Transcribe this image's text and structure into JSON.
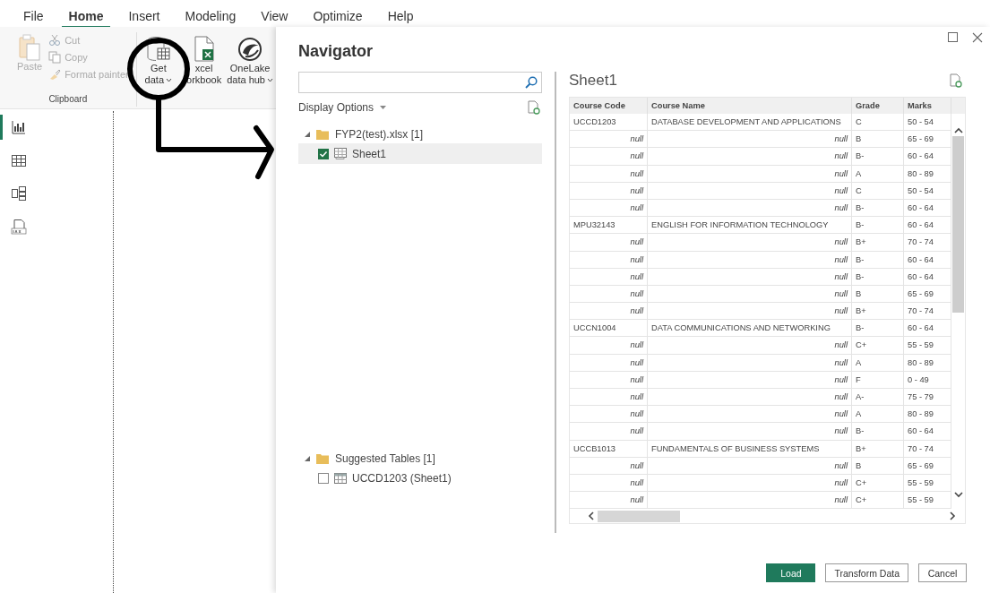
{
  "menu": [
    {
      "label": "File",
      "selected": false
    },
    {
      "label": "Home",
      "selected": true
    },
    {
      "label": "Insert",
      "selected": false
    },
    {
      "label": "Modeling",
      "selected": false
    },
    {
      "label": "View",
      "selected": false
    },
    {
      "label": "Optimize",
      "selected": false
    },
    {
      "label": "Help",
      "selected": false
    }
  ],
  "ribbon": {
    "clipboard": {
      "paste": "Paste",
      "cut": "Cut",
      "copy": "Copy",
      "format_painter": "Format painter",
      "label": "Clipboard",
      "disabled": true
    },
    "get_data": {
      "line1": "Get",
      "line2": "data"
    },
    "excel": {
      "line1": "xcel",
      "line2": "orkbook"
    },
    "onelake": {
      "line1": "OneLake",
      "line2": "data hub"
    }
  },
  "sidebar": [
    {
      "kind": "report",
      "selected": true
    },
    {
      "kind": "table",
      "selected": false
    },
    {
      "kind": "model",
      "selected": false
    },
    {
      "kind": "dax",
      "selected": false
    }
  ],
  "navigator": {
    "title": "Navigator",
    "display_options": "Display Options",
    "tree": [
      {
        "label": "FYP2(test).xlsx [1]",
        "expanded": true,
        "children": [
          {
            "label": "Sheet1",
            "kind": "sheet",
            "checked": true,
            "selected": true
          }
        ]
      },
      {
        "label": "Suggested Tables [1]",
        "expanded": true,
        "children": [
          {
            "label": "UCCD1203 (Sheet1)",
            "kind": "table",
            "checked": false,
            "selected": false
          }
        ]
      }
    ]
  },
  "preview": {
    "title": "Sheet1",
    "columns": [
      "Course Code",
      "Course Name",
      "Grade",
      "Marks"
    ],
    "rows": [
      {
        "kind": "course",
        "cells": [
          "UCCD1203",
          "DATABASE DEVELOPMENT AND APPLICATIONS",
          "C",
          "50 - 54"
        ]
      },
      {
        "kind": "null",
        "cells": [
          "null",
          "null",
          "B",
          "65 - 69"
        ]
      },
      {
        "kind": "null",
        "cells": [
          "null",
          "null",
          "B-",
          "60 - 64"
        ]
      },
      {
        "kind": "null",
        "cells": [
          "null",
          "null",
          "A",
          "80 - 89"
        ]
      },
      {
        "kind": "null",
        "cells": [
          "null",
          "null",
          "C",
          "50 - 54"
        ]
      },
      {
        "kind": "null",
        "cells": [
          "null",
          "null",
          "B-",
          "60 - 64"
        ]
      },
      {
        "kind": "course",
        "cells": [
          "MPU32143",
          "ENGLISH FOR INFORMATION TECHNOLOGY",
          "B-",
          "60 - 64"
        ]
      },
      {
        "kind": "null",
        "cells": [
          "null",
          "null",
          "B+",
          "70 - 74"
        ]
      },
      {
        "kind": "null",
        "cells": [
          "null",
          "null",
          "B-",
          "60 - 64"
        ]
      },
      {
        "kind": "null",
        "cells": [
          "null",
          "null",
          "B-",
          "60 - 64"
        ]
      },
      {
        "kind": "null",
        "cells": [
          "null",
          "null",
          "B",
          "65 - 69"
        ]
      },
      {
        "kind": "null",
        "cells": [
          "null",
          "null",
          "B+",
          "70 - 74"
        ]
      },
      {
        "kind": "course",
        "cells": [
          "UCCN1004",
          "DATA COMMUNICATIONS AND NETWORKING",
          "B-",
          "60 - 64"
        ]
      },
      {
        "kind": "null",
        "cells": [
          "null",
          "null",
          "C+",
          "55 - 59"
        ]
      },
      {
        "kind": "null",
        "cells": [
          "null",
          "null",
          "A",
          "80 - 89"
        ]
      },
      {
        "kind": "null",
        "cells": [
          "null",
          "null",
          "F",
          "0 - 49"
        ]
      },
      {
        "kind": "null",
        "cells": [
          "null",
          "null",
          "A-",
          "75 - 79"
        ]
      },
      {
        "kind": "null",
        "cells": [
          "null",
          "null",
          "A",
          "80 - 89"
        ]
      },
      {
        "kind": "null",
        "cells": [
          "null",
          "null",
          "B-",
          "60 - 64"
        ]
      },
      {
        "kind": "course",
        "cells": [
          "UCCB1013",
          "FUNDAMENTALS OF BUSINESS SYSTEMS",
          "B+",
          "70 - 74"
        ]
      },
      {
        "kind": "null",
        "cells": [
          "null",
          "null",
          "B",
          "65 - 69"
        ]
      },
      {
        "kind": "null",
        "cells": [
          "null",
          "null",
          "C+",
          "55 - 59"
        ]
      },
      {
        "kind": "null",
        "cells": [
          "null",
          "null",
          "C+",
          "55 - 59"
        ]
      }
    ]
  },
  "buttons": [
    {
      "label": "Load",
      "kind": "primary"
    },
    {
      "label": "Transform Data",
      "kind": "secondary"
    },
    {
      "label": "Cancel",
      "kind": "secondary"
    }
  ]
}
